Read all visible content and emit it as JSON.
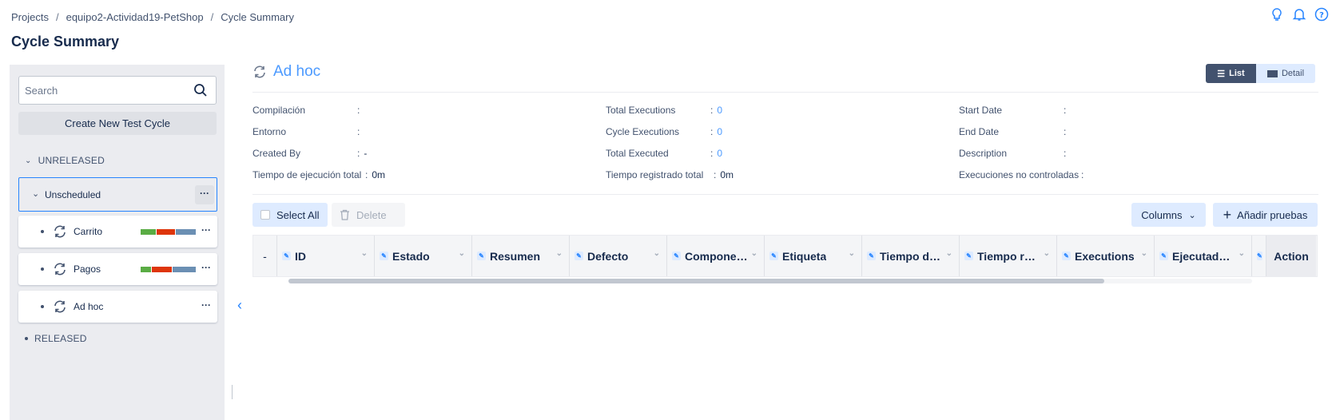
{
  "breadcrumb": [
    "Projects",
    "equipo2-Actividad19-PetShop",
    "Cycle Summary"
  ],
  "page_title": "Cycle Summary",
  "top_icons": [
    "lightbulb-icon",
    "bell-icon",
    "help-icon"
  ],
  "sidebar": {
    "search_placeholder": "Search",
    "create_button": "Create New Test Cycle",
    "unreleased_label": "UNRELEASED",
    "unscheduled_label": "Unscheduled",
    "more_label": "···",
    "cycles": [
      {
        "name": "Carrito",
        "progress": [
          {
            "color": "#5aac44",
            "share": 0.29
          },
          {
            "color": "#de350b",
            "share": 0.33
          },
          {
            "color": "#6b8fb3",
            "share": 0.38
          }
        ]
      },
      {
        "name": "Pagos",
        "progress": [
          {
            "color": "#5aac44",
            "share": 0.19
          },
          {
            "color": "#de350b",
            "share": 0.38
          },
          {
            "color": "#6b8fb3",
            "share": 0.43
          }
        ]
      },
      {
        "name": "Ad hoc",
        "progress": []
      }
    ],
    "released_label": "RELEASED"
  },
  "main": {
    "title": "Ad hoc",
    "view": {
      "list": "List",
      "detail": "Detail"
    },
    "meta": {
      "col1": [
        {
          "label": "Compilación",
          "sep": ":",
          "value": ""
        },
        {
          "label": "Entorno",
          "sep": ":",
          "value": ""
        },
        {
          "label": "Created By",
          "sep": ":",
          "value": "-"
        },
        {
          "label": "Tiempo de ejecución total",
          "sep": ":",
          "value": "0m"
        }
      ],
      "col2": [
        {
          "label": "Total Executions",
          "sep": ":",
          "value": "0"
        },
        {
          "label": "Cycle Executions",
          "sep": ":",
          "value": "0"
        },
        {
          "label": "Total Executed",
          "sep": ":",
          "value": "0"
        },
        {
          "label": "Tiempo registrado total",
          "sep": ":",
          "value": "0m"
        }
      ],
      "col3": [
        {
          "label": "Start Date",
          "sep": ":",
          "value": ""
        },
        {
          "label": "End Date",
          "sep": ":",
          "value": ""
        },
        {
          "label": "Description",
          "sep": ":",
          "value": ""
        },
        {
          "label": "Execuciones no controladas",
          "sep": ":",
          "value": ""
        }
      ]
    },
    "toolbar": {
      "select_all": "Select All",
      "delete": "Delete",
      "columns": "Columns",
      "add_tests": "Añadir pruebas"
    },
    "grid": {
      "first_col": "-",
      "columns": [
        "ID",
        "Estado",
        "Resumen",
        "Defecto",
        "Componentes",
        "Etiqueta",
        "Tiempo de ejecución",
        "Tiempo registrado",
        "Executions",
        "Ejecutado por",
        ""
      ],
      "action_col": "Action"
    }
  },
  "colors": {
    "accent": "#4c9aff",
    "selected_border": "#2684ff",
    "list_bg": "#42526e"
  }
}
